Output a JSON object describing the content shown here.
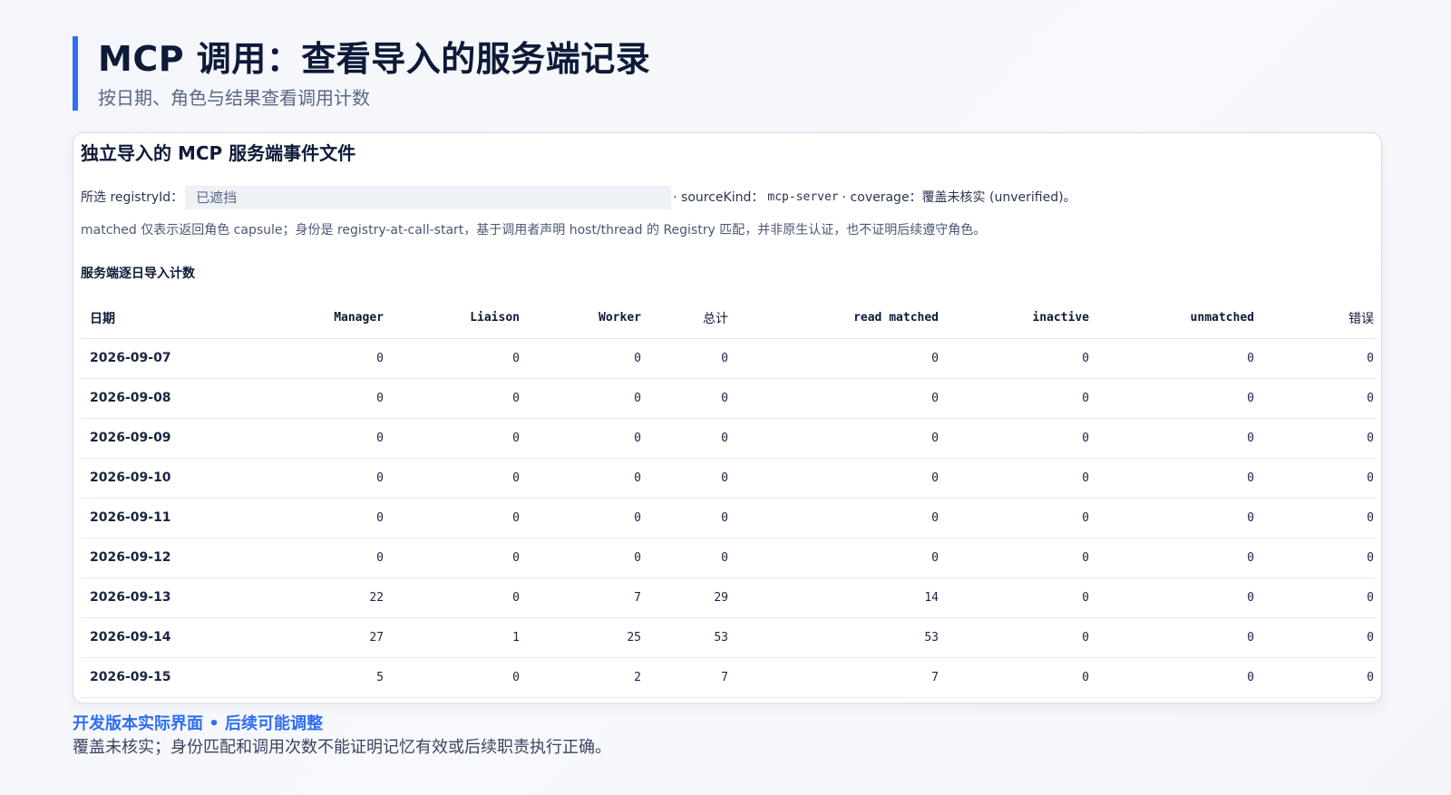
{
  "page": {
    "title": "MCP 调用：查看导入的服务端记录",
    "subtitle": "按日期、角色与结果查看调用计数"
  },
  "card": {
    "title": "独立导入的 MCP 服务端事件文件",
    "meta": {
      "registry_label": "所选 registryId：",
      "registry_value": "已遮挡",
      "source_kind_label": "· sourceKind：",
      "source_kind_value": "mcp-server",
      "coverage_label": "· coverage：",
      "coverage_value": "覆盖未核实 (unverified)。"
    },
    "note": "matched 仅表示返回角色 capsule；身份是 registry-at-call-start，基于调用者声明 host/thread 的 Registry 匹配，并非原生认证，也不证明后续遵守角色。",
    "table": {
      "heading": "服务端逐日导入计数",
      "columns": [
        "日期",
        "Manager",
        "Liaison",
        "Worker",
        "总计",
        "read matched",
        "inactive",
        "unmatched",
        "错误"
      ],
      "rows": [
        [
          "2026-09-07",
          "0",
          "0",
          "0",
          "0",
          "0",
          "0",
          "0",
          "0"
        ],
        [
          "2026-09-08",
          "0",
          "0",
          "0",
          "0",
          "0",
          "0",
          "0",
          "0"
        ],
        [
          "2026-09-09",
          "0",
          "0",
          "0",
          "0",
          "0",
          "0",
          "0",
          "0"
        ],
        [
          "2026-09-10",
          "0",
          "0",
          "0",
          "0",
          "0",
          "0",
          "0",
          "0"
        ],
        [
          "2026-09-11",
          "0",
          "0",
          "0",
          "0",
          "0",
          "0",
          "0",
          "0"
        ],
        [
          "2026-09-12",
          "0",
          "0",
          "0",
          "0",
          "0",
          "0",
          "0",
          "0"
        ],
        [
          "2026-09-13",
          "22",
          "0",
          "7",
          "29",
          "14",
          "0",
          "0",
          "0"
        ],
        [
          "2026-09-14",
          "27",
          "1",
          "25",
          "53",
          "53",
          "0",
          "0",
          "0"
        ],
        [
          "2026-09-15",
          "5",
          "0",
          "2",
          "7",
          "7",
          "0",
          "0",
          "0"
        ]
      ]
    }
  },
  "footer": {
    "label": "开发版本实际界面 • 后续可能调整",
    "text": "覆盖未核实；身份匹配和调用次数不能证明记忆有效或后续职责执行正确。"
  },
  "colors": {
    "accent": "#2f6df6",
    "title": "#0d1a38",
    "muted": "#5a6785",
    "border": "#d6ddea"
  }
}
